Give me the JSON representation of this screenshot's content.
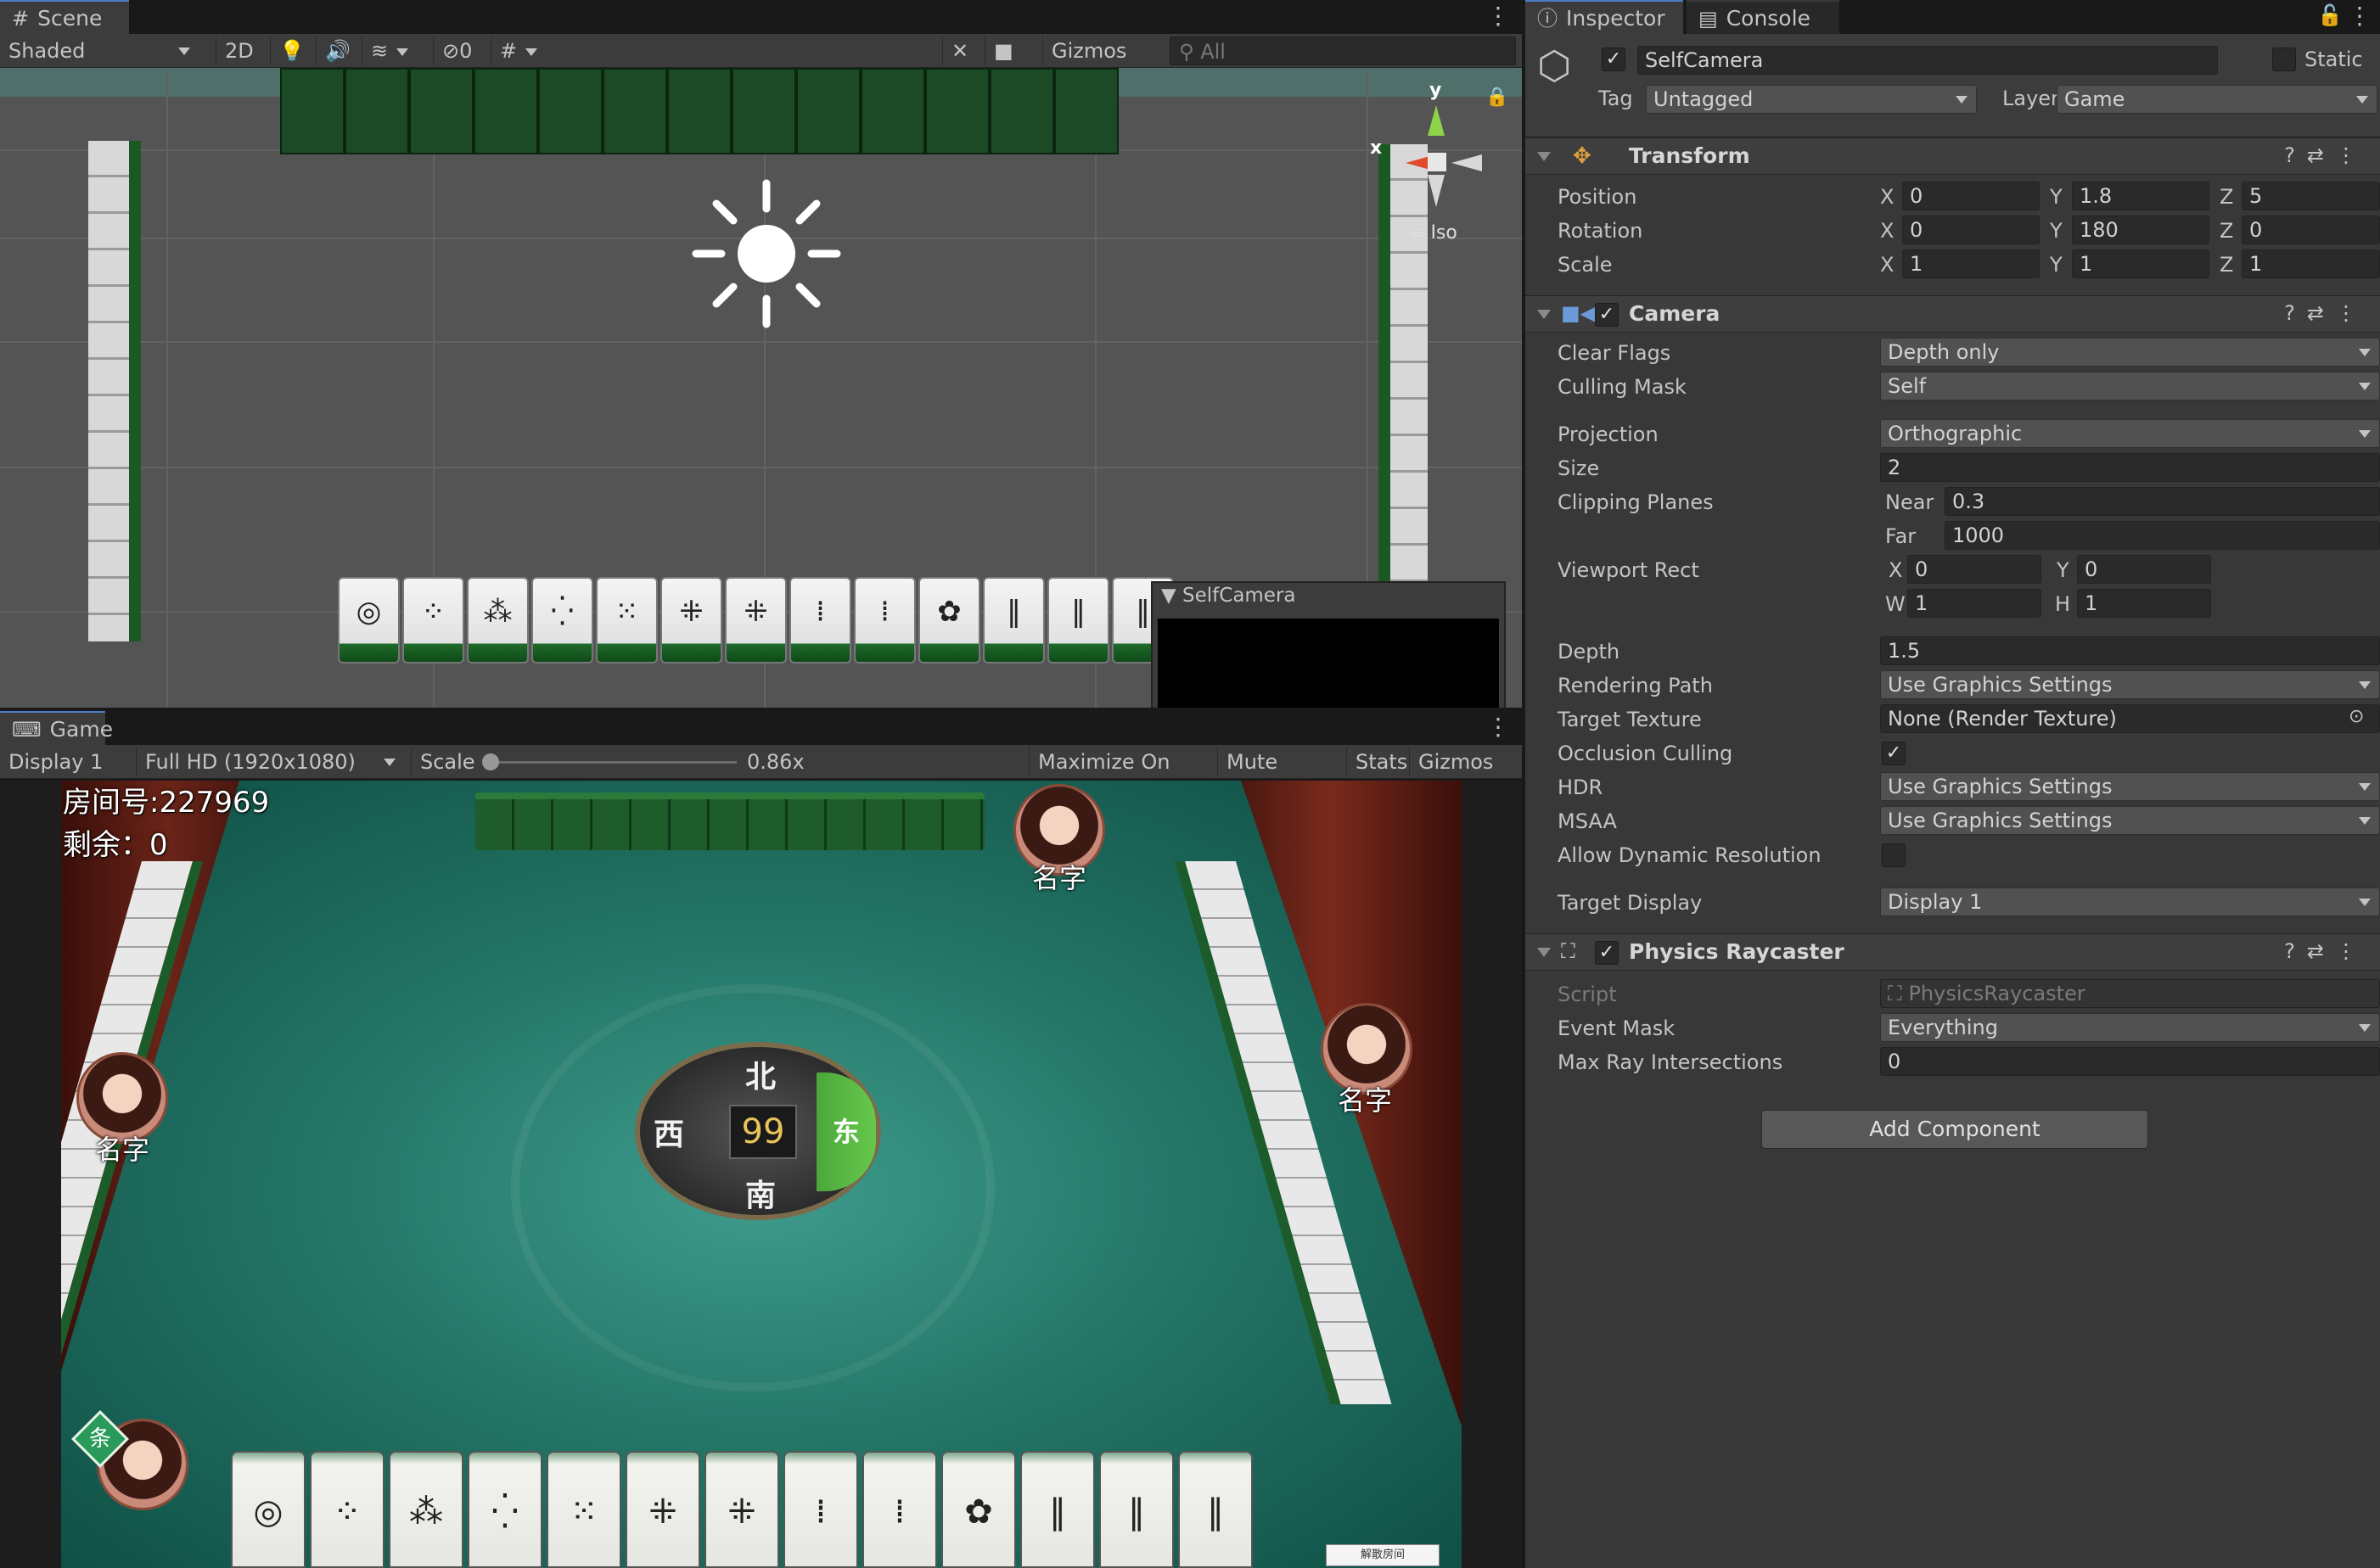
{
  "scene_panel": {
    "tab_label": "Scene",
    "shade_mode": "Shaded",
    "btn_2d": "2D",
    "hidden_count": "0",
    "gizmos_label": "Gizmos",
    "search_placeholder": "All",
    "gizmo_y": "y",
    "gizmo_x": "x",
    "iso_label": "Iso",
    "preview_title": "SelfCamera",
    "scene_tile_faces": [
      "◎",
      "⁘",
      "⁂",
      "⁛",
      "⁙",
      "⁜",
      "⁜",
      "⁞",
      "⁞",
      "✿",
      "‖",
      "‖",
      "‖"
    ]
  },
  "game_panel": {
    "tab_label": "Game",
    "display": "Display 1",
    "resolution": "Full HD (1920x1080)",
    "scale_label": "Scale",
    "scale_value": "0.86x",
    "scale_fraction": 0.0,
    "maximize": "Maximize On Play",
    "mute": "Mute Audio",
    "stats": "Stats",
    "gizmos": "Gizmos",
    "room_number": "房间号:227969",
    "remaining": "剩余：0",
    "player_name": "名字",
    "compass_center": "99",
    "compass_north": "北",
    "compass_west": "西",
    "compass_south": "南",
    "compass_east": "东",
    "badge": "条",
    "dismiss_button": "解散房间",
    "hand_tile_faces": [
      "◎",
      "⁘",
      "⁂",
      "⁛",
      "⁙",
      "⁜",
      "⁜",
      "⁞",
      "⁞",
      "✿",
      "‖",
      "‖",
      "‖"
    ]
  },
  "inspector": {
    "tab_inspector": "Inspector",
    "tab_console": "Console",
    "object_name": "SelfCamera",
    "static_label": "Static",
    "tag_label": "Tag",
    "tag_value": "Untagged",
    "layer_label": "Layer",
    "layer_value": "Game",
    "transform": {
      "title": "Transform",
      "position_label": "Position",
      "pos_x": "0",
      "pos_y": "1.8",
      "pos_z": "5",
      "rotation_label": "Rotation",
      "rot_x": "0",
      "rot_y": "180",
      "rot_z": "0",
      "scale_label": "Scale",
      "scl_x": "1",
      "scl_y": "1",
      "scl_z": "1"
    },
    "camera": {
      "title": "Camera",
      "clear_flags_label": "Clear Flags",
      "clear_flags": "Depth only",
      "culling_mask_label": "Culling Mask",
      "culling_mask": "Self",
      "projection_label": "Projection",
      "projection": "Orthographic",
      "size_label": "Size",
      "size": "2",
      "clipping_label": "Clipping Planes",
      "near_label": "Near",
      "near": "0.3",
      "far_label": "Far",
      "far": "1000",
      "viewport_label": "Viewport Rect",
      "vx": "0",
      "vy": "0",
      "vw": "1",
      "vh": "1",
      "depth_label": "Depth",
      "depth": "1.5",
      "rendering_path_label": "Rendering Path",
      "rendering_path": "Use Graphics Settings",
      "target_texture_label": "Target Texture",
      "target_texture": "None (Render Texture)",
      "occlusion_label": "Occlusion Culling",
      "hdr_label": "HDR",
      "hdr": "Use Graphics Settings",
      "msaa_label": "MSAA",
      "msaa": "Use Graphics Settings",
      "dyn_res_label": "Allow Dynamic Resolution",
      "target_display_label": "Target Display",
      "target_display": "Display 1"
    },
    "raycaster": {
      "title": "Physics Raycaster",
      "script_label": "Script",
      "script": "PhysicsRaycaster",
      "event_mask_label": "Event Mask",
      "event_mask": "Everything",
      "max_ray_label": "Max Ray Intersections",
      "max_ray": "0"
    },
    "add_component": "Add Component"
  }
}
